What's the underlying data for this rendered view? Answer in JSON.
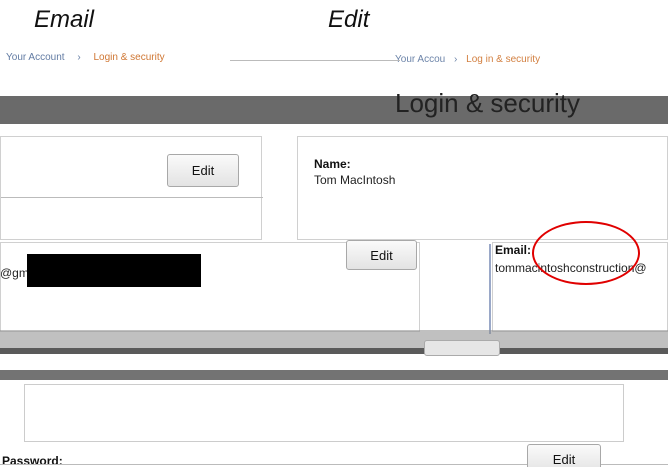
{
  "captions": {
    "email": "Email",
    "edit": "Edit"
  },
  "breadcrumb_left": {
    "account": "Your Account",
    "separator": "›",
    "section": "Login & security"
  },
  "breadcrumb_right": {
    "account": "Your Accou",
    "separator": "›",
    "section": "Log in & security"
  },
  "page_title": "Login & security",
  "name_panel": {
    "label": "Name:",
    "value": "Tom MacIntosh"
  },
  "email_panel": {
    "label": "Email:",
    "value": "tommacintoshconstruction@"
  },
  "left_email_fragment": "@gm",
  "buttons": {
    "edit_top": "Edit",
    "edit_email": "Edit",
    "edit_password": "Edit"
  },
  "password_label": "Password:",
  "colors": {
    "annotation_circle": "#e00000",
    "redaction": "#000000"
  }
}
